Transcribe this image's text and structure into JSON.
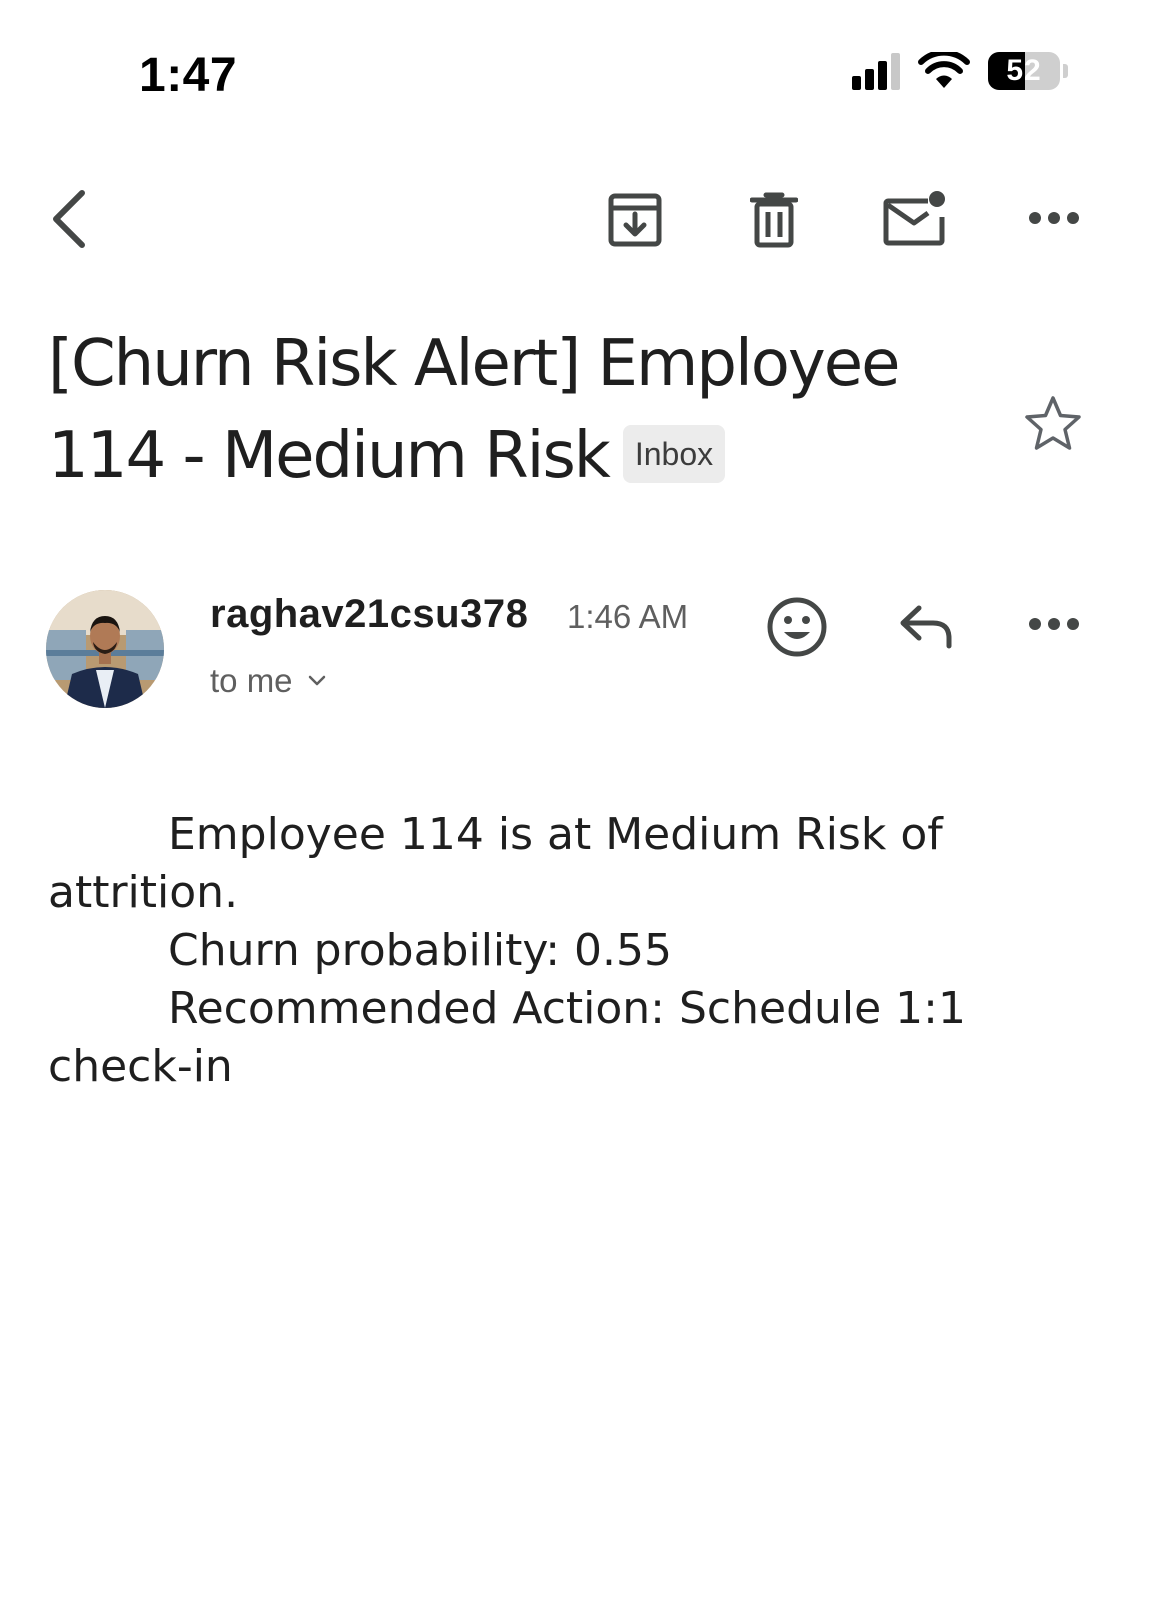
{
  "status_bar": {
    "time": "1:47",
    "battery_level": "52",
    "battery_fraction": 0.52,
    "signal_bars": 3,
    "signal_bars_total": 4
  },
  "toolbar": {
    "back_icon": "chevron-left-icon",
    "archive_icon": "archive-icon",
    "delete_icon": "trash-icon",
    "mark_unread_icon": "mail-unread-icon",
    "more_icon": "more-horizontal-icon"
  },
  "email": {
    "subject": "[Churn Risk Alert] Employee 114 - Medium Risk",
    "label": "Inbox",
    "starred": false,
    "sender": "raghav21csu378",
    "time": "1:46 AM",
    "recipient": "to me",
    "body": {
      "line1": "Employee 114 is at Medium Risk of",
      "line1_cont": "attrition.",
      "line2": "Churn probability: 0.55",
      "line3": "Recommended Action: Schedule 1:1",
      "line3_cont": "check-in"
    }
  },
  "colors": {
    "text": "#1f1f1f",
    "secondary_text": "#5f5f5f",
    "icon": "#444746",
    "chip_bg": "#ececec",
    "background": "#ffffff"
  }
}
